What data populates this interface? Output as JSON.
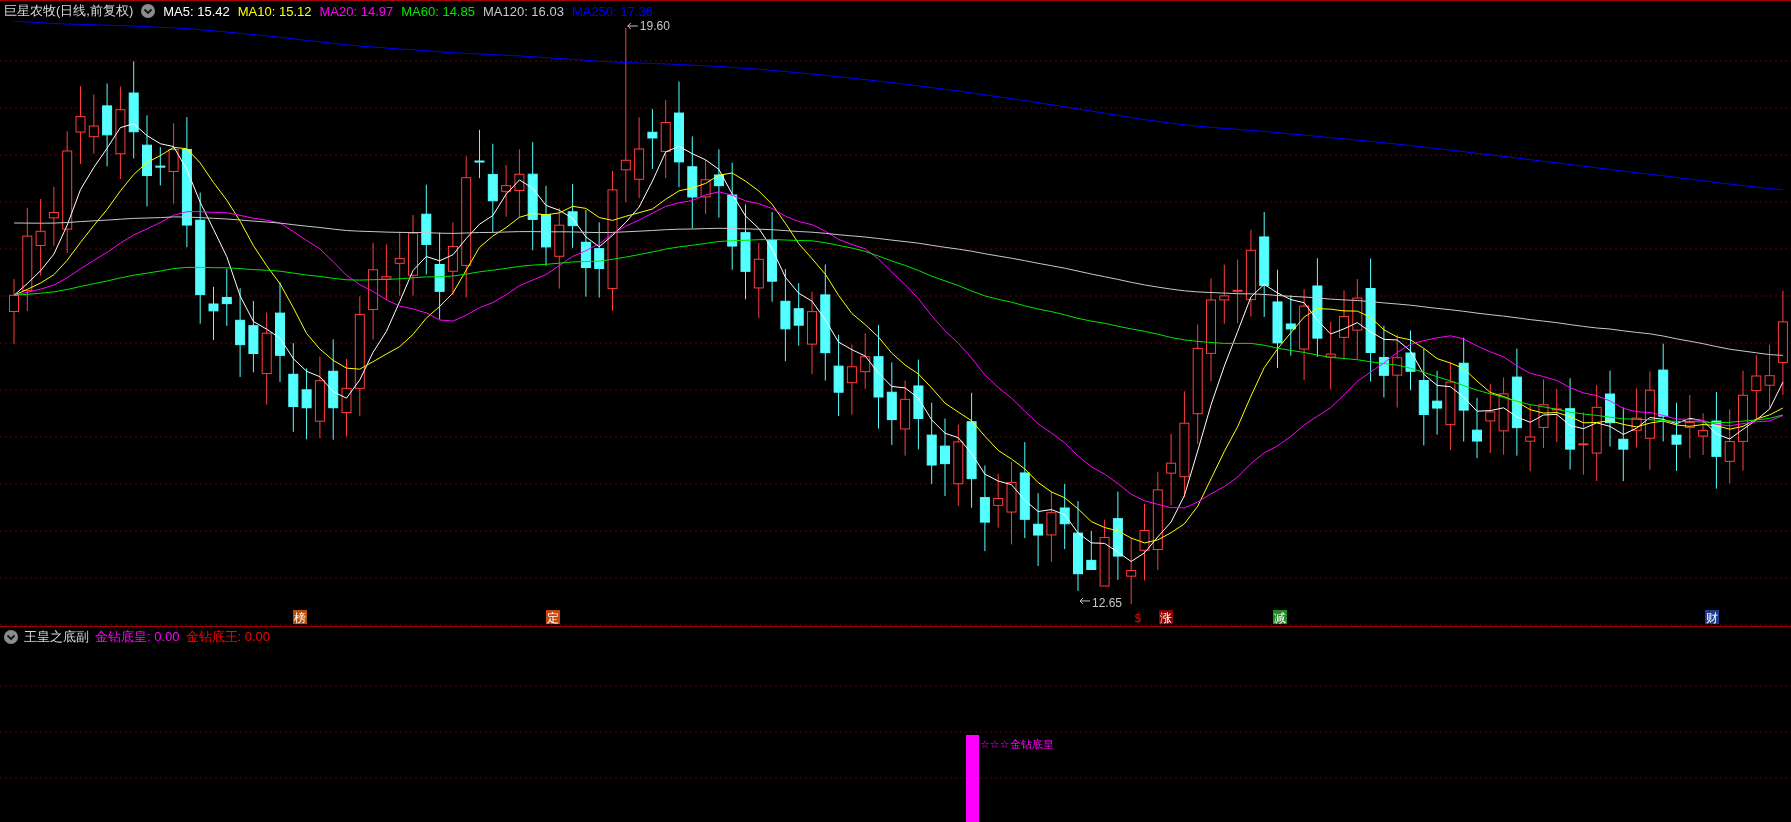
{
  "main_chart": {
    "title": "巨星农牧(日线,前复权)",
    "ma_legend": [
      {
        "label": "MA5: 15.42",
        "color": "#ffffff"
      },
      {
        "label": "MA10: 15.12",
        "color": "#ffff00"
      },
      {
        "label": "MA20: 14.97",
        "color": "#ff00ff"
      },
      {
        "label": "MA60: 14.85",
        "color": "#00e600"
      },
      {
        "label": "MA120: 16.03",
        "color": "#c8c8c8"
      },
      {
        "label": "MA250: 17.36",
        "color": "#0000ff"
      }
    ],
    "high_label": "19.60",
    "low_label": "12.65",
    "signal_tags": [
      {
        "text": "榜",
        "kind": "badge",
        "color": "#b4500a"
      },
      {
        "text": "定",
        "kind": "badge",
        "color": "#c8460a"
      },
      {
        "text": "$",
        "kind": "plain",
        "color": "#ff0000"
      },
      {
        "text": "涨",
        "kind": "badge",
        "color": "#8c0000"
      },
      {
        "text": "减",
        "kind": "badge",
        "color": "#1e8c1e"
      },
      {
        "text": "财",
        "kind": "badge",
        "color": "#1e3c8c"
      }
    ]
  },
  "sub_chart": {
    "title": "王皇之底副",
    "legend": [
      {
        "label": "金钻底皇: 0.00",
        "color": "#ff00ff"
      },
      {
        "label": "金钻底王: 0.00",
        "color": "#ff0000"
      }
    ],
    "signal_label": "☆☆☆金钻底皇"
  }
}
